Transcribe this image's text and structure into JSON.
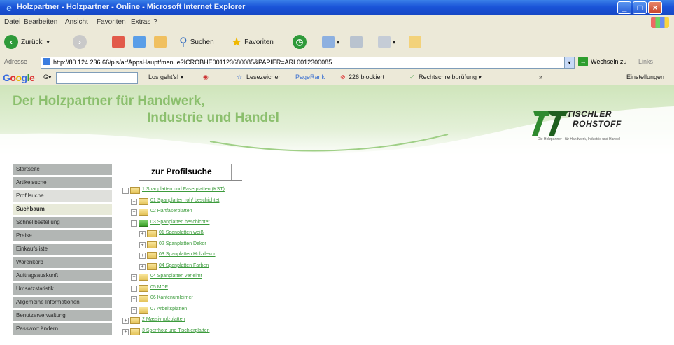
{
  "window": {
    "title": "Holzpartner - Holzpartner - Online - Microsoft Internet Explorer"
  },
  "menu": [
    "Datei",
    "Bearbeiten",
    "Ansicht",
    "Favoriten",
    "Extras",
    "?"
  ],
  "toolbar": {
    "back_label": "Zurück",
    "search_label": "Suchen",
    "favorites_label": "Favoriten"
  },
  "address": {
    "label": "Adresse",
    "url": "http://80.124.236.66/pls/ar/AppsHaupt/menue?ICROBHE001123680085&PAPIER=ARL0012300085",
    "go_label": "Wechseln zu",
    "links_label": "Links"
  },
  "googlebar": {
    "logo": "Google",
    "g_suffix": "G▾",
    "search_web": "Los geht's! ▾",
    "bookmarks": "Lesezeichen",
    "pagerank": "PageRank",
    "popups_blocked": "226 blockiert",
    "spellcheck": "Rechtschreibprüfung ▾",
    "settings": "Einstellungen"
  },
  "banner": {
    "line1": "Der Holzpartner für Handwerk,",
    "line2": "Industrie und Handel",
    "logo_line1": "TISCHLER",
    "logo_line2": "ROHSTOFF",
    "logo_tag": "Die Holzpartner - für Handwerk, Industrie und Handel"
  },
  "sidebar": [
    {
      "label": "Startseite",
      "state": "normal"
    },
    {
      "label": "Artikelsuche",
      "state": "normal"
    },
    {
      "label": "Profilsuche",
      "state": "light"
    },
    {
      "label": "Suchbaum",
      "state": "active"
    },
    {
      "label": "Schnellbestellung",
      "state": "normal"
    },
    {
      "label": "Preise",
      "state": "normal"
    },
    {
      "label": "Einkaufsliste",
      "state": "normal"
    },
    {
      "label": "Warenkorb",
      "state": "normal"
    },
    {
      "label": "Auftragsauskunft",
      "state": "normal"
    },
    {
      "label": "Umsatzstatistik",
      "state": "normal"
    },
    {
      "label": "Allgemeine Informationen",
      "state": "normal"
    },
    {
      "label": "Benutzerverwaltung",
      "state": "normal"
    },
    {
      "label": "Passwort ändern",
      "state": "normal"
    }
  ],
  "tab": {
    "label": "zur Profilsuche"
  },
  "tree": [
    {
      "label": "1 Spanplatten und Faserplatten (KST)",
      "level": 0,
      "toggle": "−",
      "open": false
    },
    {
      "label": "01 Spanplatten roh/ beschichtet",
      "level": 1,
      "toggle": "+",
      "open": false
    },
    {
      "label": "02 Hartfaserplatten",
      "level": 1,
      "toggle": "+",
      "open": false
    },
    {
      "label": "03 Spanplatten beschichtet",
      "level": 1,
      "toggle": "−",
      "open": true
    },
    {
      "label": "01 Spanplatten weiß",
      "level": 2,
      "toggle": "+",
      "open": false
    },
    {
      "label": "02 Spanplatten Dekor",
      "level": 2,
      "toggle": "+",
      "open": false
    },
    {
      "label": "03 Spanplatten Holzdekor",
      "level": 2,
      "toggle": "+",
      "open": false
    },
    {
      "label": "04 Spanplatten Farben",
      "level": 2,
      "toggle": "+",
      "open": false
    },
    {
      "label": "04 Spanplatten verleimt",
      "level": 1,
      "toggle": "+",
      "open": false
    },
    {
      "label": "05 MDF",
      "level": 1,
      "toggle": "+",
      "open": false
    },
    {
      "label": "06 Kantenumleimer",
      "level": 1,
      "toggle": "+",
      "open": false
    },
    {
      "label": "07 Arbeitsplatten",
      "level": 1,
      "toggle": "+",
      "open": false
    },
    {
      "label": "2 Massivholzplatten",
      "level": 0,
      "toggle": "+",
      "open": false
    },
    {
      "label": "3 Sperrholz und Tischlerplatten",
      "level": 0,
      "toggle": "+",
      "open": false
    }
  ]
}
